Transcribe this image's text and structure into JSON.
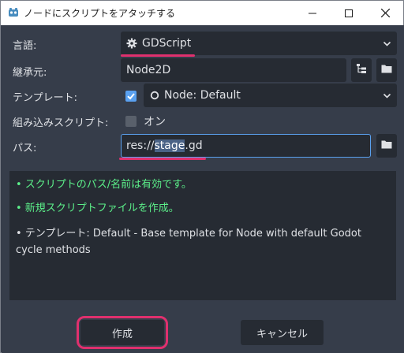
{
  "window": {
    "title": "ノードにスクリプトをアタッチする"
  },
  "form": {
    "language": {
      "label": "言語:",
      "value": "GDScript"
    },
    "inherits": {
      "label": "継承元:",
      "value": "Node2D"
    },
    "template": {
      "label": "テンプレート:",
      "checked": true,
      "value": "Node: Default"
    },
    "builtin": {
      "label": "組み込みスクリプト:",
      "checked": false,
      "value_label": "オン"
    },
    "path": {
      "label": "パス:",
      "prefix": "res://",
      "selected": "stage",
      "suffix": ".gd"
    }
  },
  "messages": {
    "line1": "•  スクリプトのパス/名前は有効です。",
    "line2": "•  新規スクリプトファイルを作成。",
    "line3": "•  テンプレート: Default - Base template for Node with default Godot",
    "line4": "cycle methods"
  },
  "buttons": {
    "create": "作成",
    "cancel": "キャンセル"
  },
  "colors": {
    "accent": "#e0306e",
    "ok_text": "#5cf08a",
    "checkbox_on": "#5aa1f0",
    "focus_border": "#5aa1f0"
  },
  "icons": {
    "language": "gear-icon",
    "inherits_tree": "tree-icon",
    "folder": "folder-icon",
    "template_node": "node-circle-icon"
  }
}
